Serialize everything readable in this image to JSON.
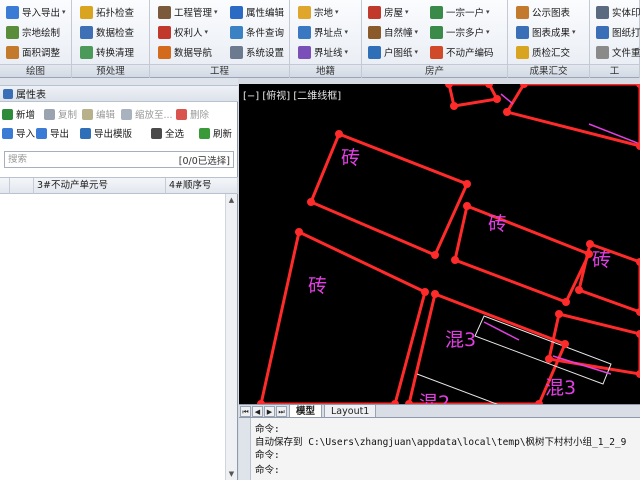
{
  "ribbon": {
    "groups": [
      {
        "title": "绘图",
        "items": [
          {
            "label": "导入导出",
            "icon": "import-export-icon",
            "color": "#3a7bd5",
            "dropdown": true
          },
          {
            "label": "宗地绘制",
            "icon": "parcel-draw-icon",
            "color": "#5a8d3a",
            "dropdown": false
          },
          {
            "label": "面积调整",
            "icon": "area-adjust-icon",
            "color": "#c47a2c",
            "dropdown": false
          }
        ]
      },
      {
        "title": "预处理",
        "items": [
          {
            "label": "拓扑检查",
            "icon": "topology-check-icon",
            "color": "#d9a520",
            "dropdown": false
          },
          {
            "label": "数据检查",
            "icon": "data-check-icon",
            "color": "#3f6fb5",
            "dropdown": false
          },
          {
            "label": "转换清理",
            "icon": "convert-clean-icon",
            "color": "#4b9a5a",
            "dropdown": false
          }
        ]
      },
      {
        "title": "工程",
        "items": [
          {
            "label": "工程管理",
            "icon": "project-manage-icon",
            "color": "#7a5a3a",
            "dropdown": true
          },
          {
            "label": "属性编辑",
            "icon": "attribute-edit-icon",
            "color": "#2c6bc4",
            "dropdown": false
          },
          {
            "label": "权利人",
            "icon": "owner-icon",
            "color": "#c0392b",
            "dropdown": true
          },
          {
            "label": "条件查询",
            "icon": "condition-query-icon",
            "color": "#3b82c4",
            "dropdown": false
          },
          {
            "label": "数据导航",
            "icon": "data-nav-icon",
            "color": "#d46a1c",
            "dropdown": false
          },
          {
            "label": "系统设置",
            "icon": "settings-icon",
            "color": "#6b7a8f",
            "dropdown": false
          }
        ]
      },
      {
        "title": "地籍",
        "items": [
          {
            "label": "宗地",
            "icon": "parcel-icon",
            "color": "#e0a52c",
            "dropdown": true
          },
          {
            "label": "界址点",
            "icon": "boundary-point-icon",
            "color": "#3a78c2",
            "dropdown": true
          },
          {
            "label": "界址线",
            "icon": "boundary-line-icon",
            "color": "#7b4fb8",
            "dropdown": true
          }
        ]
      },
      {
        "title": "房产",
        "items": [
          {
            "label": "房屋",
            "icon": "house-icon",
            "color": "#c0392b",
            "dropdown": true
          },
          {
            "label": "自然幢",
            "icon": "building-icon",
            "color": "#8a5a2b",
            "dropdown": true
          },
          {
            "label": "户图纸",
            "icon": "unit-drawing-icon",
            "color": "#2e6fb8",
            "dropdown": true
          },
          {
            "label": "一宗一户",
            "icon": "one-parcel-one-unit-icon",
            "color": "#3a8a4a",
            "dropdown": true
          },
          {
            "label": "一宗多户",
            "icon": "one-parcel-multi-unit-icon",
            "color": "#3a8a4a",
            "dropdown": true
          },
          {
            "label": "不动产编码",
            "icon": "property-code-icon",
            "color": "#d04a2a",
            "dropdown": false
          }
        ]
      },
      {
        "title": "成果汇交",
        "items": [
          {
            "label": "公示图表",
            "icon": "public-chart-icon",
            "color": "#c47a2c",
            "dropdown": false
          },
          {
            "label": "图表成果",
            "icon": "chart-result-icon",
            "color": "#3a6fb8",
            "dropdown": true
          },
          {
            "label": "质检汇交",
            "icon": "qc-submit-icon",
            "color": "#d9a520",
            "dropdown": false
          }
        ]
      },
      {
        "title": "工",
        "items": [
          {
            "label": "实体印",
            "icon": "entity-print-icon",
            "color": "#5a6a80",
            "dropdown": false
          },
          {
            "label": "图纸打",
            "icon": "print-drawing-icon",
            "color": "#3a6fb8",
            "dropdown": false
          },
          {
            "label": "文件重",
            "icon": "file-rename-icon",
            "color": "#8a8a8a",
            "dropdown": false
          }
        ]
      }
    ]
  },
  "panel": {
    "title": "属性表",
    "toolbar_row1": [
      {
        "label": "新增",
        "icon": "add-icon",
        "color": "#2e8b3a",
        "enabled": true
      },
      {
        "label": "复制",
        "icon": "copy-icon",
        "color": "#9aa3b0",
        "enabled": false
      },
      {
        "label": "编辑",
        "icon": "edit-icon",
        "color": "#b8b08a",
        "enabled": false
      },
      {
        "label": "缩放至...",
        "icon": "zoom-to-icon",
        "color": "#a9b2bf",
        "enabled": false
      },
      {
        "label": "删除",
        "icon": "delete-icon",
        "color": "#d9534f",
        "enabled": false
      }
    ],
    "toolbar_row2": [
      {
        "label": "导入",
        "icon": "import-icon",
        "color": "#3a7bd5",
        "enabled": true
      },
      {
        "label": "导出",
        "icon": "export-icon",
        "color": "#3a7bd5",
        "enabled": true
      },
      {
        "label": "导出模版",
        "icon": "export-template-icon",
        "color": "#2e6fb8",
        "enabled": true
      },
      {
        "label": "全选",
        "icon": "select-all-icon",
        "color": "#4a4a4a",
        "enabled": true
      },
      {
        "label": "刷新",
        "icon": "refresh-icon",
        "color": "#3a9a3a",
        "enabled": true
      }
    ],
    "search_placeholder": "搜索",
    "count_text": "[0/0已选择]",
    "columns": [
      "",
      "3#不动产单元号",
      "4#顺序号"
    ]
  },
  "canvas": {
    "viewport_label": "[−] [俯视] [二维线框]",
    "line_color": "#ff2a2a",
    "text_color": "#e040e0",
    "labels": {
      "brick1": "砖",
      "brick2": "砖",
      "brick3": "砖",
      "brick4": "砖",
      "mixed1": "混3",
      "mixed2": "混3",
      "mixed3": "混2"
    }
  },
  "layout_tabs": {
    "model": "模型",
    "layout1": "Layout1"
  },
  "command": {
    "line1": "命令:",
    "line2": "自动保存到 C:\\Users\\zhangjuan\\appdata\\local\\temp\\枫树下村村小组_1_2_9",
    "line3": "命令:",
    "line4": "命令:"
  }
}
